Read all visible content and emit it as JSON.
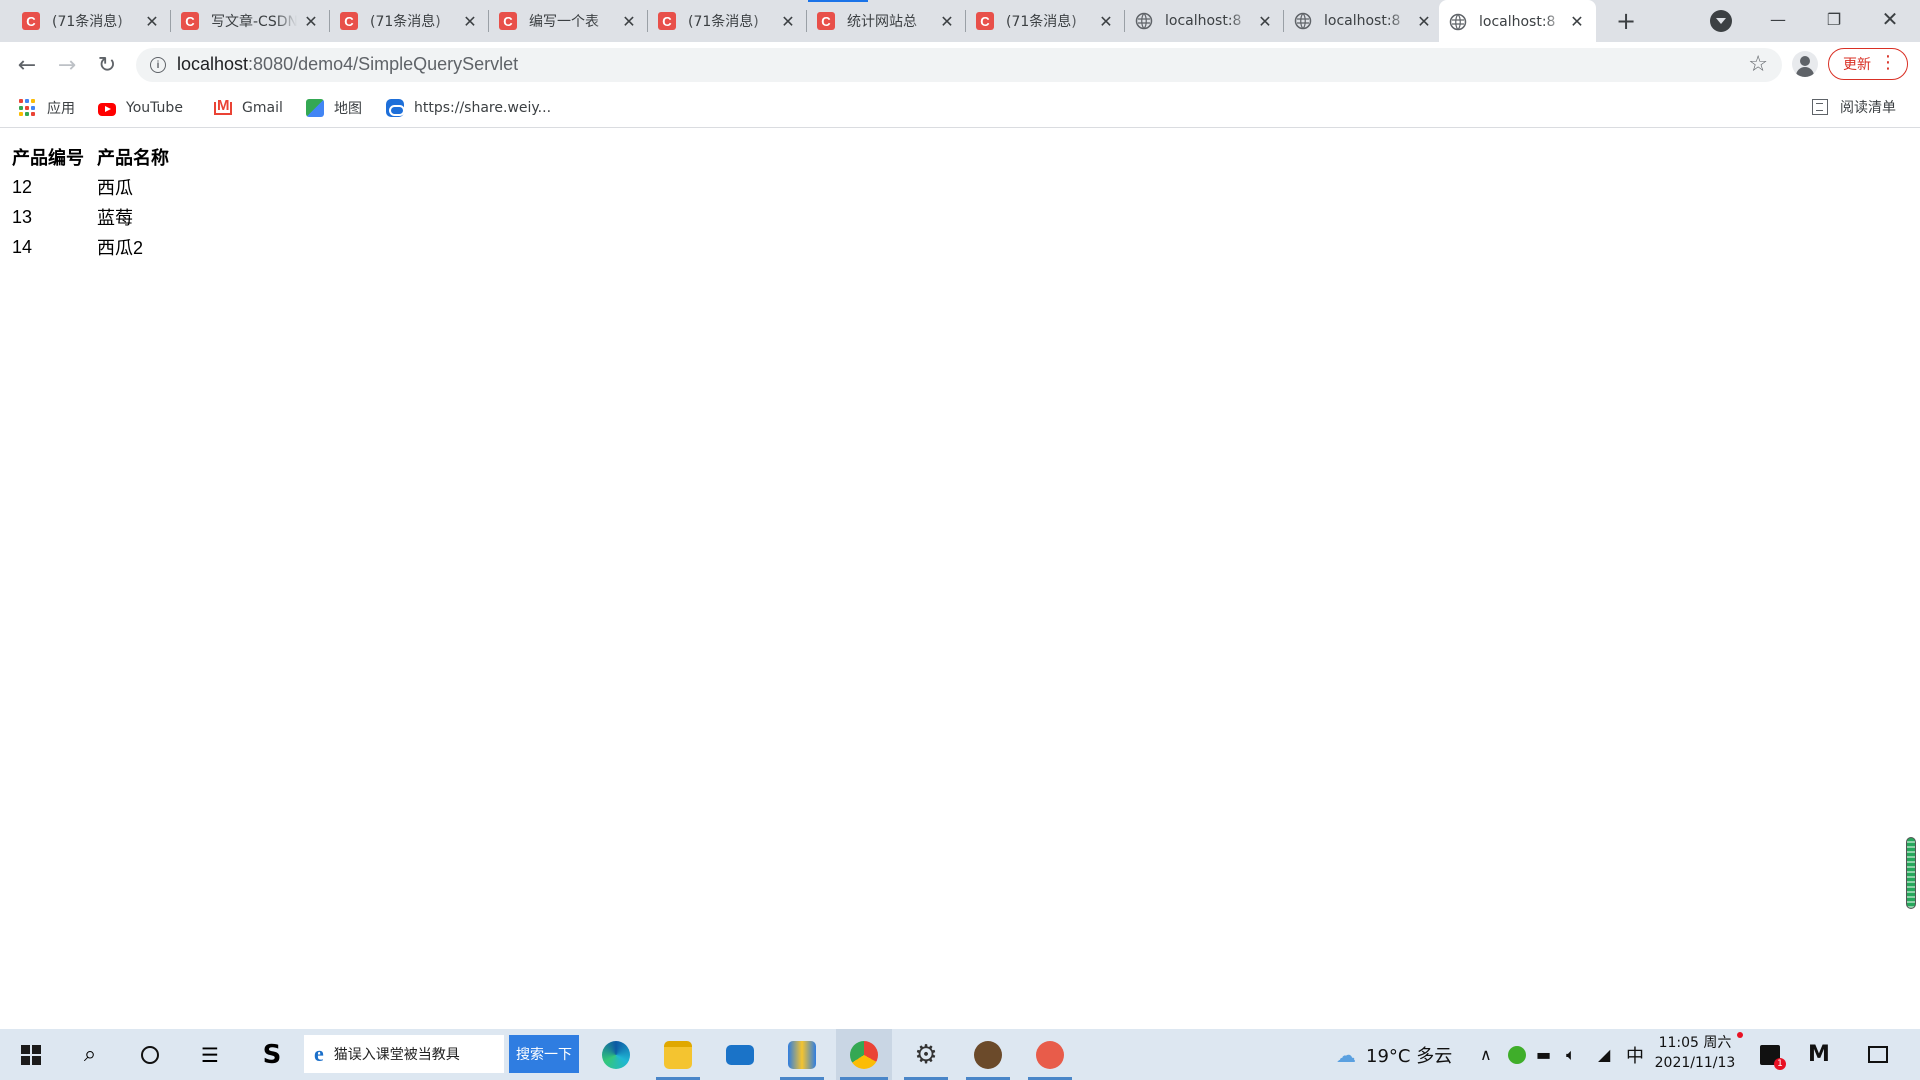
{
  "browser": {
    "tabs": [
      {
        "title": "(71条消息)",
        "favicon": "csdn"
      },
      {
        "title": "写文章-CSDN",
        "favicon": "csdn"
      },
      {
        "title": "(71条消息)",
        "favicon": "csdn"
      },
      {
        "title": "编写一个表",
        "favicon": "csdn"
      },
      {
        "title": "(71条消息)",
        "favicon": "csdn"
      },
      {
        "title": "统计网站总",
        "favicon": "csdn"
      },
      {
        "title": "(71条消息)",
        "favicon": "csdn"
      },
      {
        "title": "localhost:8",
        "favicon": "globe"
      },
      {
        "title": "localhost:8",
        "favicon": "globe"
      },
      {
        "title": "localhost:8",
        "favicon": "globe",
        "active": true
      }
    ],
    "favicon_letter": "C",
    "url_host": "localhost",
    "url_path": ":8080/demo4/SimpleQueryServlet",
    "update_label": "更新",
    "accent_color": "#1a73e8",
    "update_color": "#d93025"
  },
  "bookmarks": {
    "items": [
      {
        "label": "应用",
        "icon": "apps-icon"
      },
      {
        "label": "YouTube",
        "icon": "youtube-icon"
      },
      {
        "label": "Gmail",
        "icon": "gmail-icon"
      },
      {
        "label": "地图",
        "icon": "maps-icon"
      },
      {
        "label": "https://share.weiy...",
        "icon": "weiyun-icon"
      }
    ],
    "reading_list": "阅读清单"
  },
  "page": {
    "table": {
      "headers": [
        "产品编号",
        "产品名称"
      ],
      "rows": [
        [
          "12",
          "西瓜"
        ],
        [
          "13",
          "蓝莓"
        ],
        [
          "14",
          "西瓜2"
        ]
      ]
    }
  },
  "taskbar": {
    "search_text": "猫误入课堂被当教具",
    "search_button": "搜索一下",
    "weather": "19°C 多云",
    "ime": "中",
    "time": "11:05 周六",
    "date": "2021/11/13",
    "notification_count": "1"
  }
}
